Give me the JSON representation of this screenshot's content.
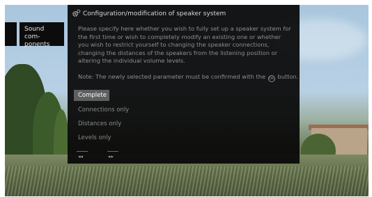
{
  "sidebar": {
    "label": "Sound com-\nponents"
  },
  "dialog": {
    "title": "Configuration/modification of speaker system",
    "description": "Please specify here whether you wish to fully set up a speaker system for the first time or wish to completely modify an existing one or whether you wish to restrict yourself to changing the speaker connections, changing the distances of the speakers from the listening position or altering the individual volume levels.",
    "note_before": "Note: The newly selected parameter must be confirmed with the",
    "note_after": "button.",
    "ok_glyph": "OK",
    "options": [
      {
        "label": "Complete",
        "selected": true
      },
      {
        "label": "Connections only",
        "selected": false
      },
      {
        "label": "Distances only",
        "selected": false
      },
      {
        "label": "Levels only",
        "selected": false
      }
    ],
    "nav": {
      "back": "◂◂",
      "forward": "▸▸"
    }
  },
  "icons": {
    "settings": "gears-icon",
    "confirm": "ok-circle-icon"
  },
  "colors": {
    "dialog_bg": "#080808",
    "selected_bg": "#5f5f5f"
  }
}
